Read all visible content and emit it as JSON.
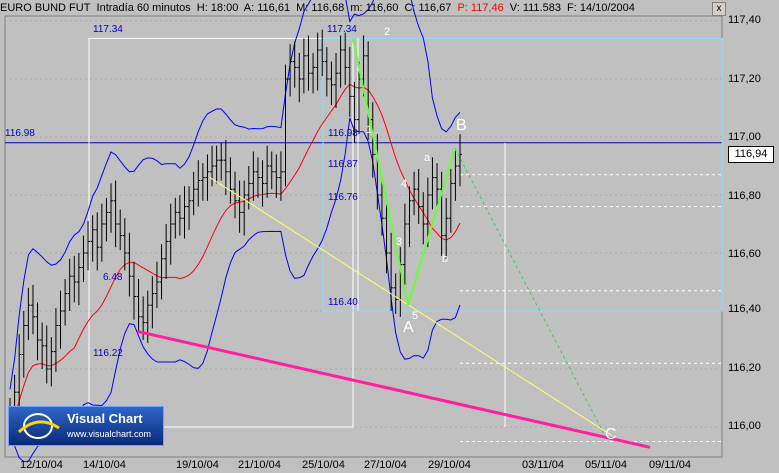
{
  "header": {
    "instrument": "EURO BUND FUT",
    "period": "Intradía 60 minutos",
    "h": "H: 18:00",
    "a": "A: 116,61",
    "m": "M: 116,68",
    "mi": "m: 116,60",
    "c": "C: 116,67",
    "p": "P: 117,46",
    "v": "V: 111.583",
    "f": "F: 14/10/2004",
    "close_label": "x"
  },
  "last_price": "116,94",
  "logo": {
    "title": "Visual Chart",
    "url": "www.visualchart.com"
  },
  "levels": {
    "l11734a": "117.34",
    "l11734b": "117.34",
    "l11698a": "116.98",
    "l11698b": "116.98",
    "l11687": "116.87",
    "l11676": "116.76",
    "l648": "6.48",
    "l11640": "116.40",
    "l11622": "116.22"
  },
  "waves": {
    "A": "A",
    "B": "B",
    "C": "C",
    "w1": "1",
    "w2": "2",
    "w3": "3",
    "w4": "4",
    "w5": "5",
    "wa": "a",
    "wb": "b"
  },
  "colors": {
    "background": "#c0c0c0",
    "bars": "#000000",
    "bollinger": "#0000ff",
    "moving_average": "#ff0000",
    "trendline_main": "#ff1f9f",
    "trendline_yellow": "#ffff66",
    "fib_lines": "#ffffff",
    "target_dotted": "#33cc66",
    "wave_green": "#66ff33"
  },
  "chart_data": {
    "type": "ohlc",
    "title": "EURO BUND FUT - Intradía 60 minutos",
    "ylim": [
      115.92,
      117.44
    ],
    "y_ticks": [
      "117,40",
      "117,20",
      "117,00",
      "116,80",
      "116,60",
      "116,40",
      "116,20",
      "116,00"
    ],
    "x_ticks": [
      "12/10/04",
      "14/10/04",
      "19/10/04",
      "21/10/04",
      "25/10/04",
      "27/10/04",
      "29/10/04",
      "03/11/04",
      "05/11/04",
      "09/11/04"
    ],
    "levels": [
      117.34,
      116.98,
      116.87,
      116.76,
      116.4,
      116.22
    ],
    "closes": [
      116.05,
      116.12,
      116.25,
      116.35,
      116.42,
      116.38,
      116.3,
      116.28,
      116.2,
      116.26,
      116.35,
      116.4,
      116.46,
      116.52,
      116.5,
      116.55,
      116.6,
      116.64,
      116.68,
      116.62,
      116.7,
      116.74,
      116.78,
      116.7,
      116.66,
      116.6,
      116.52,
      116.45,
      116.38,
      116.36,
      116.42,
      116.46,
      116.5,
      116.58,
      116.64,
      116.7,
      116.74,
      116.72,
      116.76,
      116.78,
      116.82,
      116.85,
      116.86,
      116.88,
      116.9,
      116.92,
      116.92,
      116.88,
      116.82,
      116.78,
      116.74,
      116.8,
      116.84,
      116.88,
      116.86,
      116.84,
      116.9,
      116.88,
      116.86,
      116.88,
      117.2,
      117.26,
      117.24,
      117.2,
      117.28,
      117.22,
      117.24,
      117.3,
      117.26,
      117.2,
      117.18,
      117.22,
      117.3,
      117.24,
      117.14,
      117.06,
      117.2,
      117.28,
      117.06,
      116.94,
      116.8,
      116.72,
      116.6,
      116.48,
      116.44,
      116.56,
      116.7,
      116.78,
      116.82,
      116.76,
      116.7,
      116.8,
      116.86,
      116.82,
      116.66,
      116.72,
      116.84,
      116.9,
      116.94
    ]
  }
}
